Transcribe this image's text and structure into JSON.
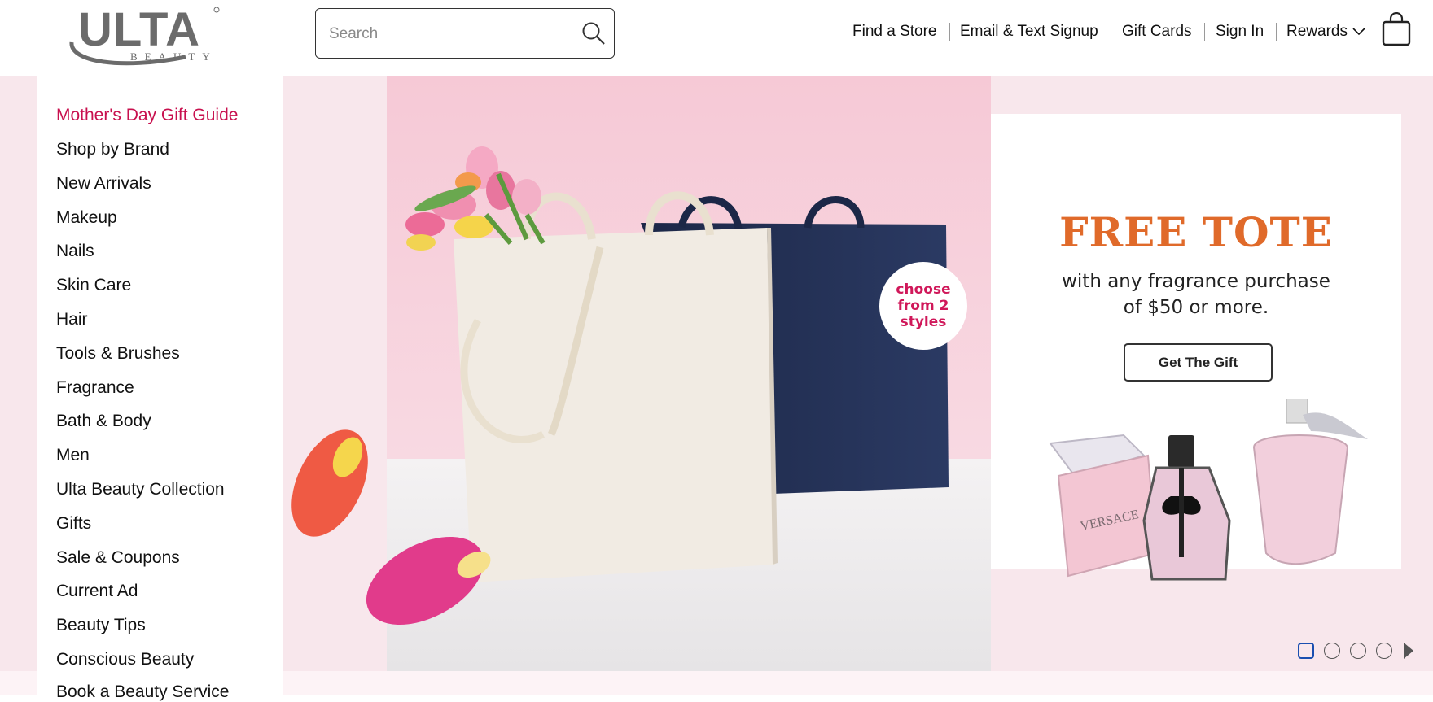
{
  "header": {
    "logo_text": "ULTA",
    "logo_subtext": "BEAUTY",
    "search": {
      "placeholder": "Search"
    },
    "links": [
      {
        "label": "Find a Store"
      },
      {
        "label": "Email & Text Signup"
      },
      {
        "label": "Gift Cards"
      },
      {
        "label": "Sign In"
      },
      {
        "label": "Rewards"
      }
    ]
  },
  "sidebar": {
    "items": [
      {
        "label": "Mother's Day Gift Guide"
      },
      {
        "label": "Shop by Brand"
      },
      {
        "label": "New Arrivals"
      },
      {
        "label": "Makeup"
      },
      {
        "label": "Nails"
      },
      {
        "label": "Skin Care"
      },
      {
        "label": "Hair"
      },
      {
        "label": "Tools & Brushes"
      },
      {
        "label": "Fragrance"
      },
      {
        "label": "Bath & Body"
      },
      {
        "label": "Men"
      },
      {
        "label": "Ulta Beauty Collection"
      },
      {
        "label": "Gifts"
      },
      {
        "label": "Sale & Coupons"
      },
      {
        "label": "Current Ad"
      },
      {
        "label": "Beauty Tips"
      },
      {
        "label": "Conscious Beauty"
      },
      {
        "label": "Book a Beauty Service"
      }
    ]
  },
  "hero": {
    "badge": "choose from 2 styles",
    "promo_title": "FREE TOTE",
    "promo_subtitle_line1": "with any fragrance purchase",
    "promo_subtitle_line2": "of $50 or more.",
    "cta_label": "Get The Gift",
    "bottle_label": "VERSACE",
    "slides_total": 4,
    "active_slide": 1
  },
  "colors": {
    "accent": "#c8104e",
    "promo_title": "#e06a2a",
    "hero_bg": "#f8e7ec",
    "active_dot": "#1a4fb0"
  }
}
